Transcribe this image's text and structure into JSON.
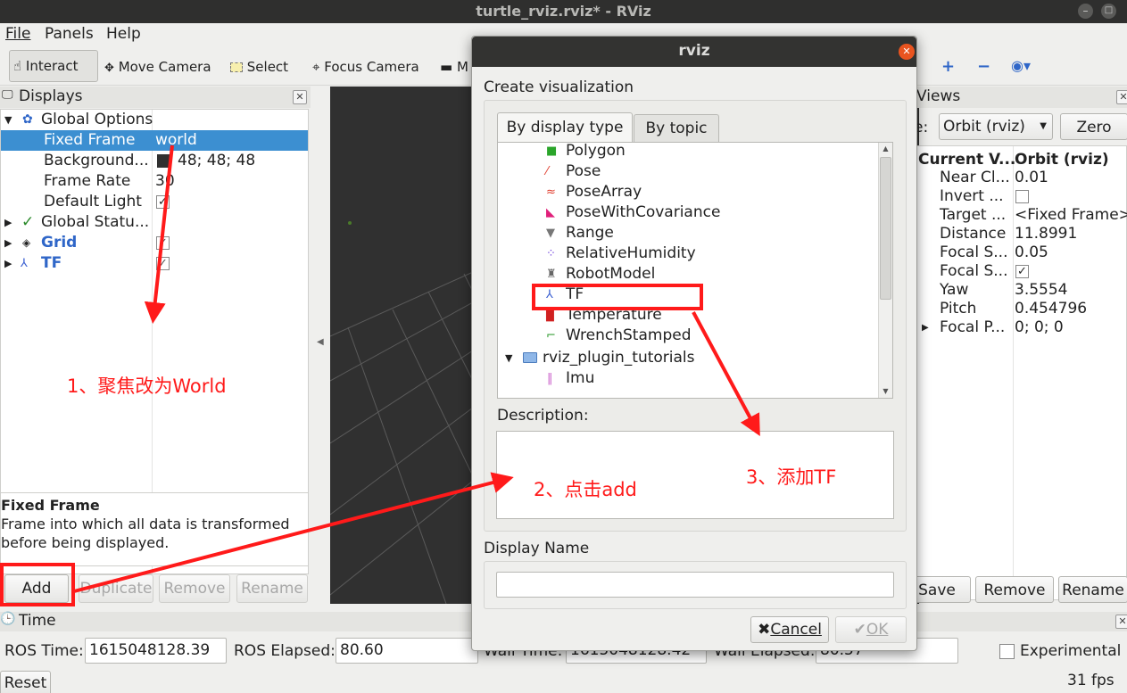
{
  "window": {
    "title": "turtle_rviz.rviz* - RViz"
  },
  "menu": [
    "File",
    "Panels",
    "Help"
  ],
  "toolbar": {
    "interact": "Interact",
    "move_camera": "Move Camera",
    "select": "Select",
    "focus_camera": "Focus Camera",
    "more": "M"
  },
  "displays": {
    "title": "Displays",
    "rows": {
      "global_options": "Global Options",
      "fixed_frame": "Fixed Frame",
      "fixed_frame_value": "world",
      "background": "Background...",
      "background_value": "48; 48; 48",
      "frame_rate": "Frame Rate",
      "frame_rate_value": "30",
      "default_light": "Default Light",
      "global_status": "Global Statu...",
      "grid": "Grid",
      "tf": "TF"
    },
    "desc_title": "Fixed Frame",
    "desc_text": "Frame into which all data is transformed before being displayed.",
    "buttons": {
      "add": "Add",
      "duplicate": "Duplicate",
      "remove": "Remove",
      "rename": "Rename"
    }
  },
  "views": {
    "title": "Views",
    "type_label": "e:",
    "type_value": "Orbit (rviz)",
    "zero": "Zero",
    "header_col1": "Current V...",
    "header_col2": "Orbit (rviz)",
    "props": [
      {
        "name": "Near Cl...",
        "value": "0.01"
      },
      {
        "name": "Invert ...",
        "value": ""
      },
      {
        "name": "Target ...",
        "value": "<Fixed Frame>"
      },
      {
        "name": "Distance",
        "value": "11.8991"
      },
      {
        "name": "Focal S...",
        "value": "0.05"
      },
      {
        "name": "Focal S...",
        "value": "✓"
      },
      {
        "name": "Yaw",
        "value": "3.5554"
      },
      {
        "name": "Pitch",
        "value": "0.454796"
      },
      {
        "name": "Focal P...",
        "value": "0; 0; 0"
      }
    ],
    "buttons": {
      "save": "Save",
      "remove": "Remove",
      "rename": "Rename"
    }
  },
  "time": {
    "title": "Time",
    "ros_time_label": "ROS Time:",
    "ros_time": "1615048128.39",
    "ros_elapsed_label": "ROS Elapsed:",
    "ros_elapsed": "80.60",
    "wall_time_label": "Wall Time:",
    "wall_time": "1615048128.42",
    "wall_elapsed_label": "Wall Elapsed:",
    "wall_elapsed": "80.57",
    "experimental": "Experimental",
    "reset": "Reset",
    "fps": "31 fps"
  },
  "dialog": {
    "title": "rviz",
    "heading": "Create visualization",
    "tabs": [
      "By display type",
      "By topic"
    ],
    "items": [
      "Polygon",
      "Pose",
      "PoseArray",
      "PoseWithCovariance",
      "Range",
      "RelativeHumidity",
      "RobotModel",
      "TF",
      "Temperature",
      "WrenchStamped"
    ],
    "group": "rviz_plugin_tutorials",
    "group_items": [
      "Imu"
    ],
    "description_label": "Description:",
    "display_name_label": "Display Name",
    "display_name_value": "",
    "cancel": "Cancel",
    "ok": "OK"
  },
  "annotations": {
    "step1": "1、聚焦改为World",
    "step2": "2、点击add",
    "step3": "3、添加TF",
    "color": "#ff1a1a"
  }
}
